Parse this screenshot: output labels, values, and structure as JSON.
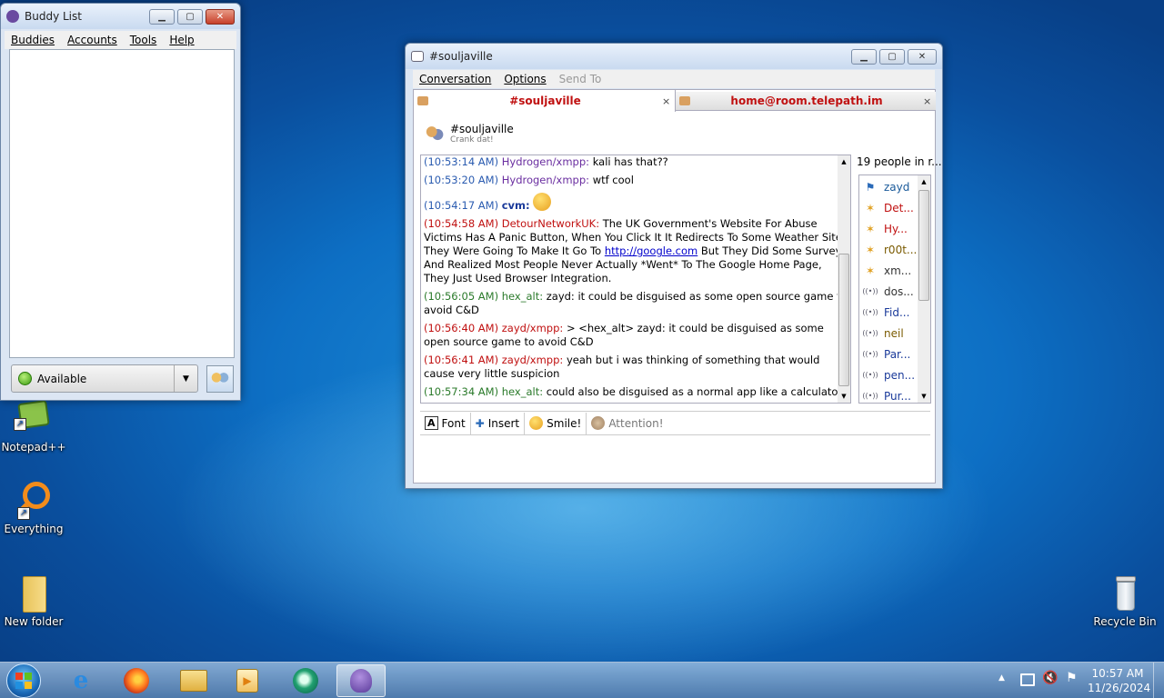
{
  "desktop": {
    "icons": [
      {
        "label": "Notepad++"
      },
      {
        "label": "Everything"
      },
      {
        "label": "New folder"
      },
      {
        "label": "Recycle Bin"
      }
    ]
  },
  "buddy_list": {
    "title": "Buddy List",
    "menu": [
      "Buddies",
      "Accounts",
      "Tools",
      "Help"
    ],
    "status": "Available"
  },
  "chat": {
    "title": "#souljaville",
    "menu": [
      "Conversation",
      "Options",
      "Send To"
    ],
    "tabs": [
      {
        "label": "#souljaville"
      },
      {
        "label": "home@room.telepath.im"
      }
    ],
    "room_name": "#souljaville",
    "room_topic": "Crank dat!",
    "messages": {
      "m1_ts": "(10:53:14 AM)",
      "m1_nick": "Hydrogen/xmpp:",
      "m1_text": "kali has that??",
      "m2_ts": "(10:53:20 AM)",
      "m2_nick": "Hydrogen/xmpp:",
      "m2_text": "wtf cool",
      "m3_ts": "(10:54:17 AM)",
      "m3_nick": "cvm:",
      "m4_ts": "(10:54:58 AM)",
      "m4_nick": "DetourNetworkUK:",
      "m4_text_a": "The UK Government's Website For Abuse Victims Has A Panic Button, When You Click It It Redirects To Some Weather Site, They Were Going To Make It Go To",
      "m4_link": "http://google.com",
      "m4_text_b": "But They Did Some Survey And Realized Most People Never Actually *Went* To The Google Home Page, They Just Used Browser Integration.",
      "m5_ts": "(10:56:05 AM)",
      "m5_nick": "hex_alt:",
      "m5_text": "zayd: it could be disguised as some open source game to avoid C&D",
      "m6_ts": "(10:56:40 AM)",
      "m6_nick": "zayd/xmpp:",
      "m6_text": "> <hex_alt> zayd: it could be disguised as some open source game to avoid C&D",
      "m7_ts": "(10:56:41 AM)",
      "m7_nick": "zayd/xmpp:",
      "m7_text": "yeah but i was thinking of something that would cause very little suspicion",
      "m8_ts": "(10:57:34 AM)",
      "m8_nick": "hex_alt:",
      "m8_text": "could also be disguised as a normal app like a calculator"
    },
    "people_count": "19 people in r...",
    "people": [
      {
        "name": "zayd",
        "icon": "flag-icon",
        "color": "#1a5a9a"
      },
      {
        "name": "Det...",
        "icon": "star-icon",
        "color": "#c01010"
      },
      {
        "name": "Hy...",
        "icon": "star-icon",
        "color": "#c01010"
      },
      {
        "name": "r00t...",
        "icon": "star-icon",
        "color": "#7a5a00"
      },
      {
        "name": "xm...",
        "icon": "star-icon",
        "color": "#333333"
      },
      {
        "name": "dos...",
        "icon": "radio-icon",
        "color": "#333333"
      },
      {
        "name": "Fid...",
        "icon": "radio-icon",
        "color": "#1a3a9a"
      },
      {
        "name": "neil",
        "icon": "radio-icon",
        "color": "#7a5a00"
      },
      {
        "name": "Par...",
        "icon": "radio-icon",
        "color": "#1a3a9a"
      },
      {
        "name": "pen...",
        "icon": "radio-icon",
        "color": "#1a3a9a"
      },
      {
        "name": "Pur...",
        "icon": "radio-icon",
        "color": "#1a3a9a"
      }
    ],
    "toolbar": {
      "font": "Font",
      "insert": "Insert",
      "smile": "Smile!",
      "attention": "Attention!"
    }
  },
  "taskbar": {
    "time": "10:57 AM",
    "date": "11/26/2024"
  }
}
